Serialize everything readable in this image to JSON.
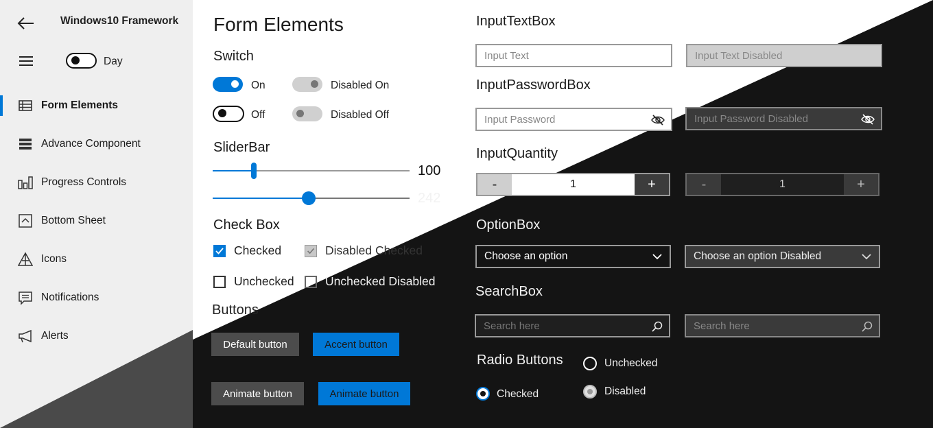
{
  "app": {
    "title": "Windows10 Framework",
    "theme_label": "Day"
  },
  "sidebar": {
    "items": [
      {
        "label": "Form Elements",
        "icon": "table-icon",
        "active": true
      },
      {
        "label": "Advance Component",
        "icon": "layers-icon"
      },
      {
        "label": "Progress Controls",
        "icon": "bar-chart-icon"
      },
      {
        "label": "Bottom Sheet",
        "icon": "bottom-sheet-icon"
      },
      {
        "label": "Icons",
        "icon": "triangle-icon"
      },
      {
        "label": "Notifications",
        "icon": "message-icon"
      },
      {
        "label": "Alerts",
        "icon": "megaphone-icon"
      }
    ]
  },
  "main": {
    "title": "Form Elements",
    "switch": {
      "heading": "Switch",
      "on": "On",
      "disabled_on": "Disabled On",
      "off": "Off",
      "disabled_off": "Disabled Off"
    },
    "slider": {
      "heading": "SliderBar",
      "value1": "100",
      "value2": "242"
    },
    "checkbox": {
      "heading": "Check Box",
      "checked": "Checked",
      "disabled_checked": "Disabled Checked",
      "unchecked": "Unchecked",
      "unchecked_disabled": "Unchecked Disabled"
    },
    "buttons": {
      "heading": "Buttons",
      "default": "Default button",
      "accent": "Accent button",
      "animate": "Animate button",
      "animate_accent": "Animate button"
    }
  },
  "right": {
    "textbox": {
      "heading": "InputTextBox",
      "placeholder": "Input Text",
      "disabled": "Input Text Disabled"
    },
    "password": {
      "heading": "InputPasswordBox",
      "placeholder": "Input Password",
      "disabled": "Input Password Disabled"
    },
    "quantity": {
      "heading": "InputQuantity",
      "minus": "-",
      "plus": "+",
      "value": "1",
      "value_disabled": "1"
    },
    "option": {
      "heading": "OptionBox",
      "value": "Choose an option",
      "disabled": "Choose an option Disabled"
    },
    "search": {
      "heading": "SearchBox",
      "placeholder": "Search here",
      "placeholder_disabled": "Search here"
    },
    "radio": {
      "heading": "Radio Buttons",
      "unchecked": "Unchecked",
      "checked": "Checked",
      "disabled": "Disabled"
    }
  },
  "colors": {
    "accent": "#0078d7",
    "dark_bg": "#141414",
    "sidebar_bg": "#efefef"
  }
}
